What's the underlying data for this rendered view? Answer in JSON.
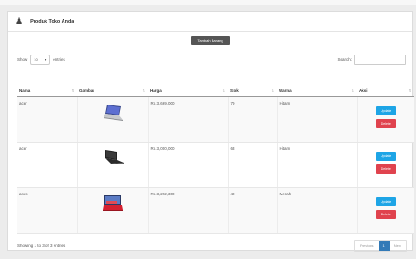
{
  "header": {
    "title": "Produk Toko Anda",
    "icon": "users-icon"
  },
  "add_button": "Tambah Barang",
  "length": {
    "show": "Show",
    "value": "10",
    "entries": "entries"
  },
  "search": {
    "label": "Search:",
    "value": ""
  },
  "table": {
    "columns": [
      "Nama",
      "Gambar",
      "Harga",
      "Stok",
      "Warna",
      "Aksi"
    ],
    "rows": [
      {
        "nama": "acer",
        "gambar": "laptop-silver-image",
        "harga": "Rp.3,699,000",
        "stok": "79",
        "warna": "Hitam"
      },
      {
        "nama": "acer",
        "gambar": "laptop-black-image",
        "harga": "Rp.3,000,000",
        "stok": "63",
        "warna": "Hitam"
      },
      {
        "nama": "asus",
        "gambar": "laptop-red-image",
        "harga": "Rp.3,222,300",
        "stok": "40",
        "warna": "Merah"
      }
    ],
    "update_label": "Update",
    "delete_label": "Delete"
  },
  "footer": {
    "info": "Showing 1 to 3 of 3 entries",
    "previous": "Previous",
    "page": "1",
    "next": "Next"
  },
  "colors": {
    "update": "#1ea5e6",
    "delete": "#e0434e",
    "active_page": "#337ab7",
    "add_button": "#555555"
  }
}
